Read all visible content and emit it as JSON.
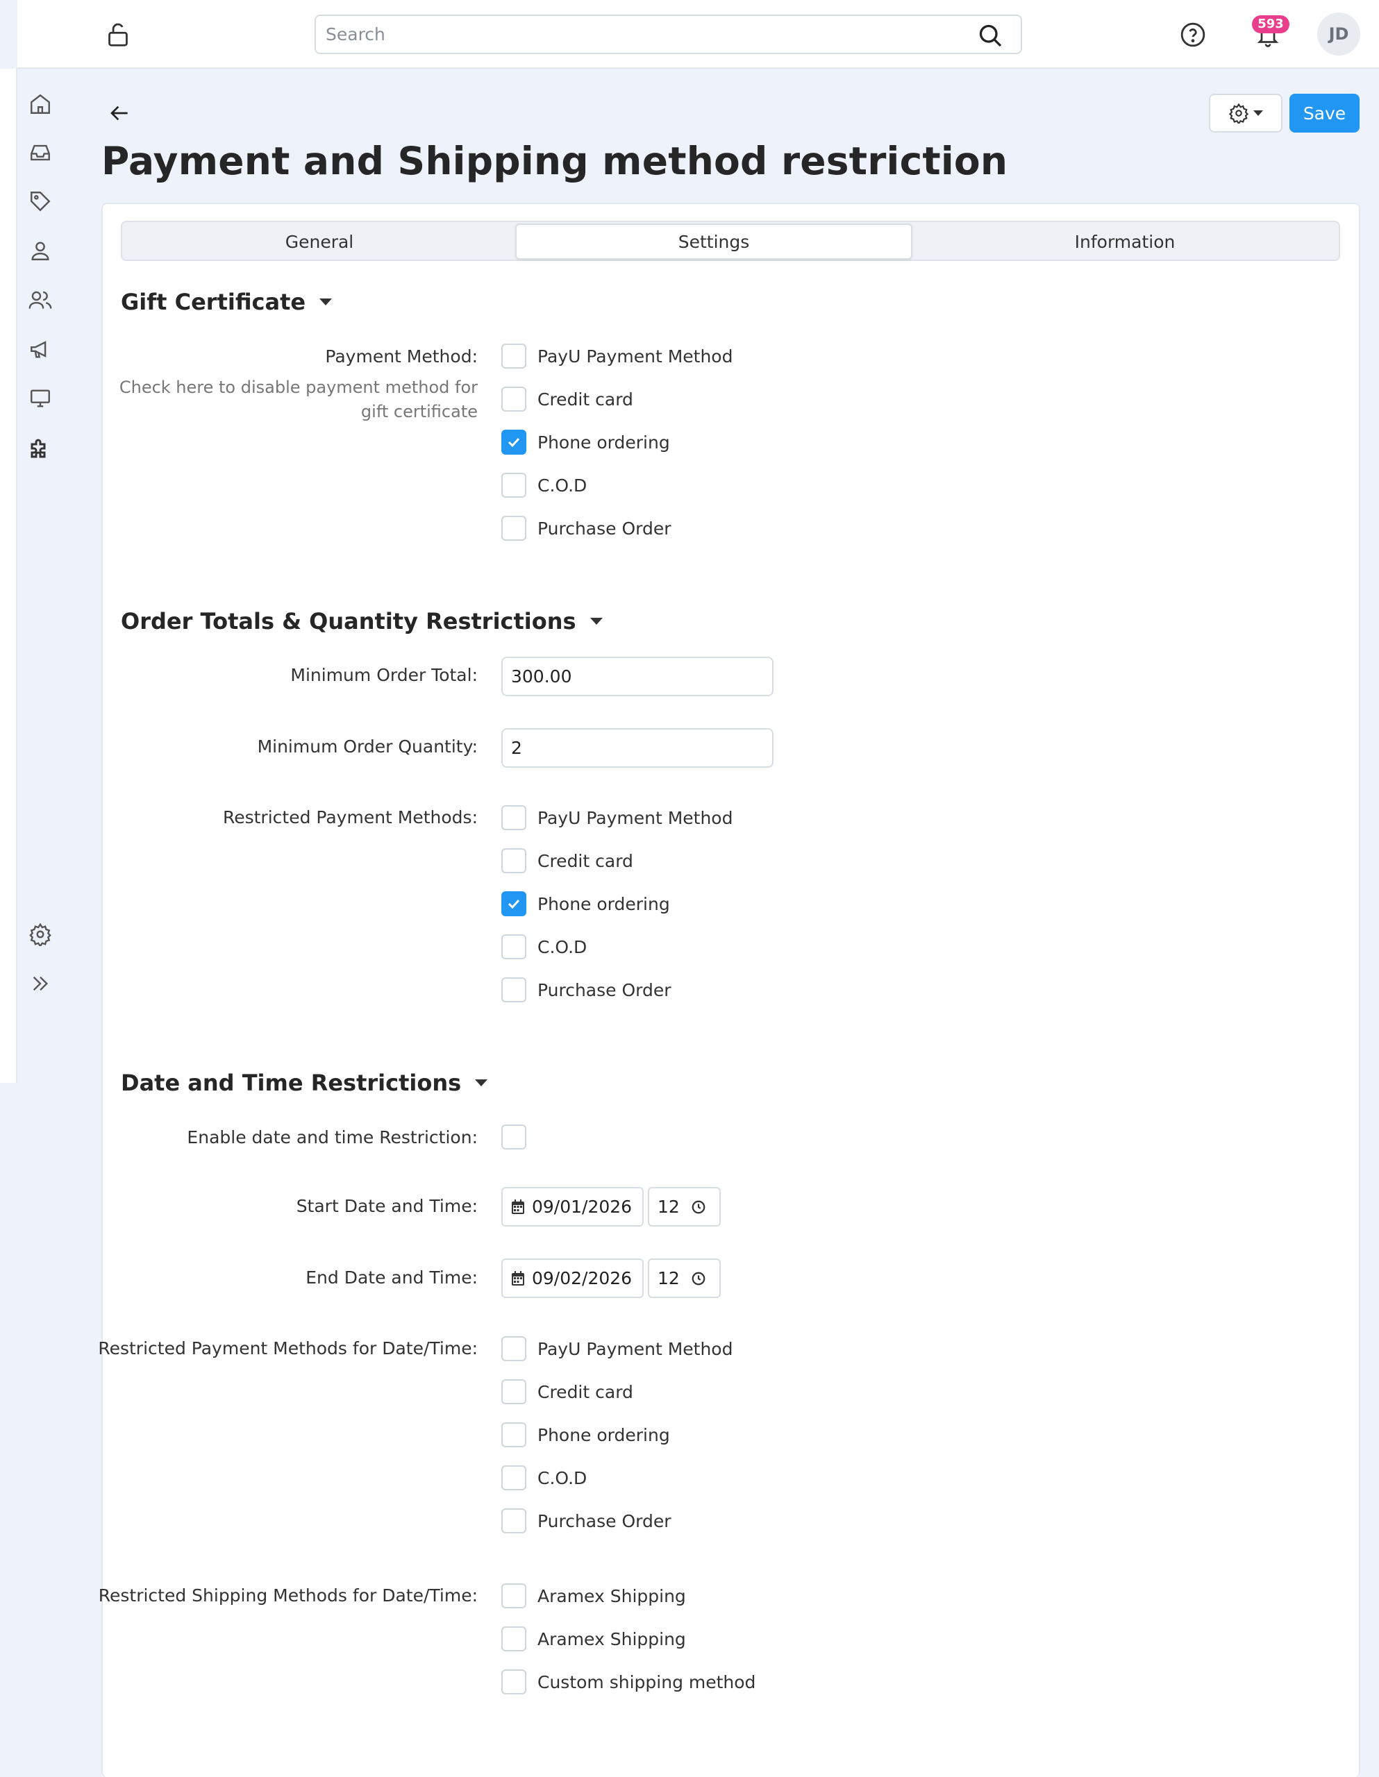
{
  "header": {
    "search_placeholder": "Search",
    "notification_count": "593",
    "avatar_initials": "JD"
  },
  "page": {
    "title": "Payment and Shipping method restriction",
    "save_label": "Save"
  },
  "tabs": [
    {
      "label": "General"
    },
    {
      "label": "Settings"
    },
    {
      "label": "Information"
    }
  ],
  "gift_certificate": {
    "title": "Gift Certificate",
    "payment_method_label": "Payment Method:",
    "help_text": "Check here to disable payment method for gift certificate",
    "options": [
      {
        "label": "PayU Payment Method",
        "checked": false
      },
      {
        "label": "Credit card",
        "checked": false
      },
      {
        "label": "Phone ordering",
        "checked": true
      },
      {
        "label": "C.O.D",
        "checked": false
      },
      {
        "label": "Purchase Order",
        "checked": false
      }
    ]
  },
  "order_totals": {
    "title": "Order Totals & Quantity Restrictions",
    "min_total_label": "Minimum Order Total:",
    "min_total_value": "300.00",
    "min_qty_label": "Minimum Order Quantity:",
    "min_qty_value": "2",
    "restricted_label": "Restricted Payment Methods:",
    "options": [
      {
        "label": "PayU Payment Method",
        "checked": false
      },
      {
        "label": "Credit card",
        "checked": false
      },
      {
        "label": "Phone ordering",
        "checked": true
      },
      {
        "label": "C.O.D",
        "checked": false
      },
      {
        "label": "Purchase Order",
        "checked": false
      }
    ]
  },
  "date_time": {
    "title": "Date and Time Restrictions",
    "enable_label": "Enable date and time Restriction:",
    "enable_checked": false,
    "start_label": "Start Date and Time:",
    "start_date": "09/01/2026",
    "start_hour": "12",
    "end_label": "End Date and Time:",
    "end_date": "09/02/2026",
    "end_hour": "12",
    "payment_label": "Restricted Payment Methods for Date/Time:",
    "payment_options": [
      {
        "label": "PayU Payment Method",
        "checked": false
      },
      {
        "label": "Credit card",
        "checked": false
      },
      {
        "label": "Phone ordering",
        "checked": false
      },
      {
        "label": "C.O.D",
        "checked": false
      },
      {
        "label": "Purchase Order",
        "checked": false
      }
    ],
    "shipping_label": "Restricted Shipping Methods for Date/Time:",
    "shipping_options": [
      {
        "label": "Aramex Shipping",
        "checked": false
      },
      {
        "label": "Aramex Shipping",
        "checked": false
      },
      {
        "label": "Custom shipping method",
        "checked": false
      }
    ]
  },
  "colors": {
    "accent": "#2196f3",
    "badge": "#e83e8c",
    "background": "#eef3fb"
  }
}
